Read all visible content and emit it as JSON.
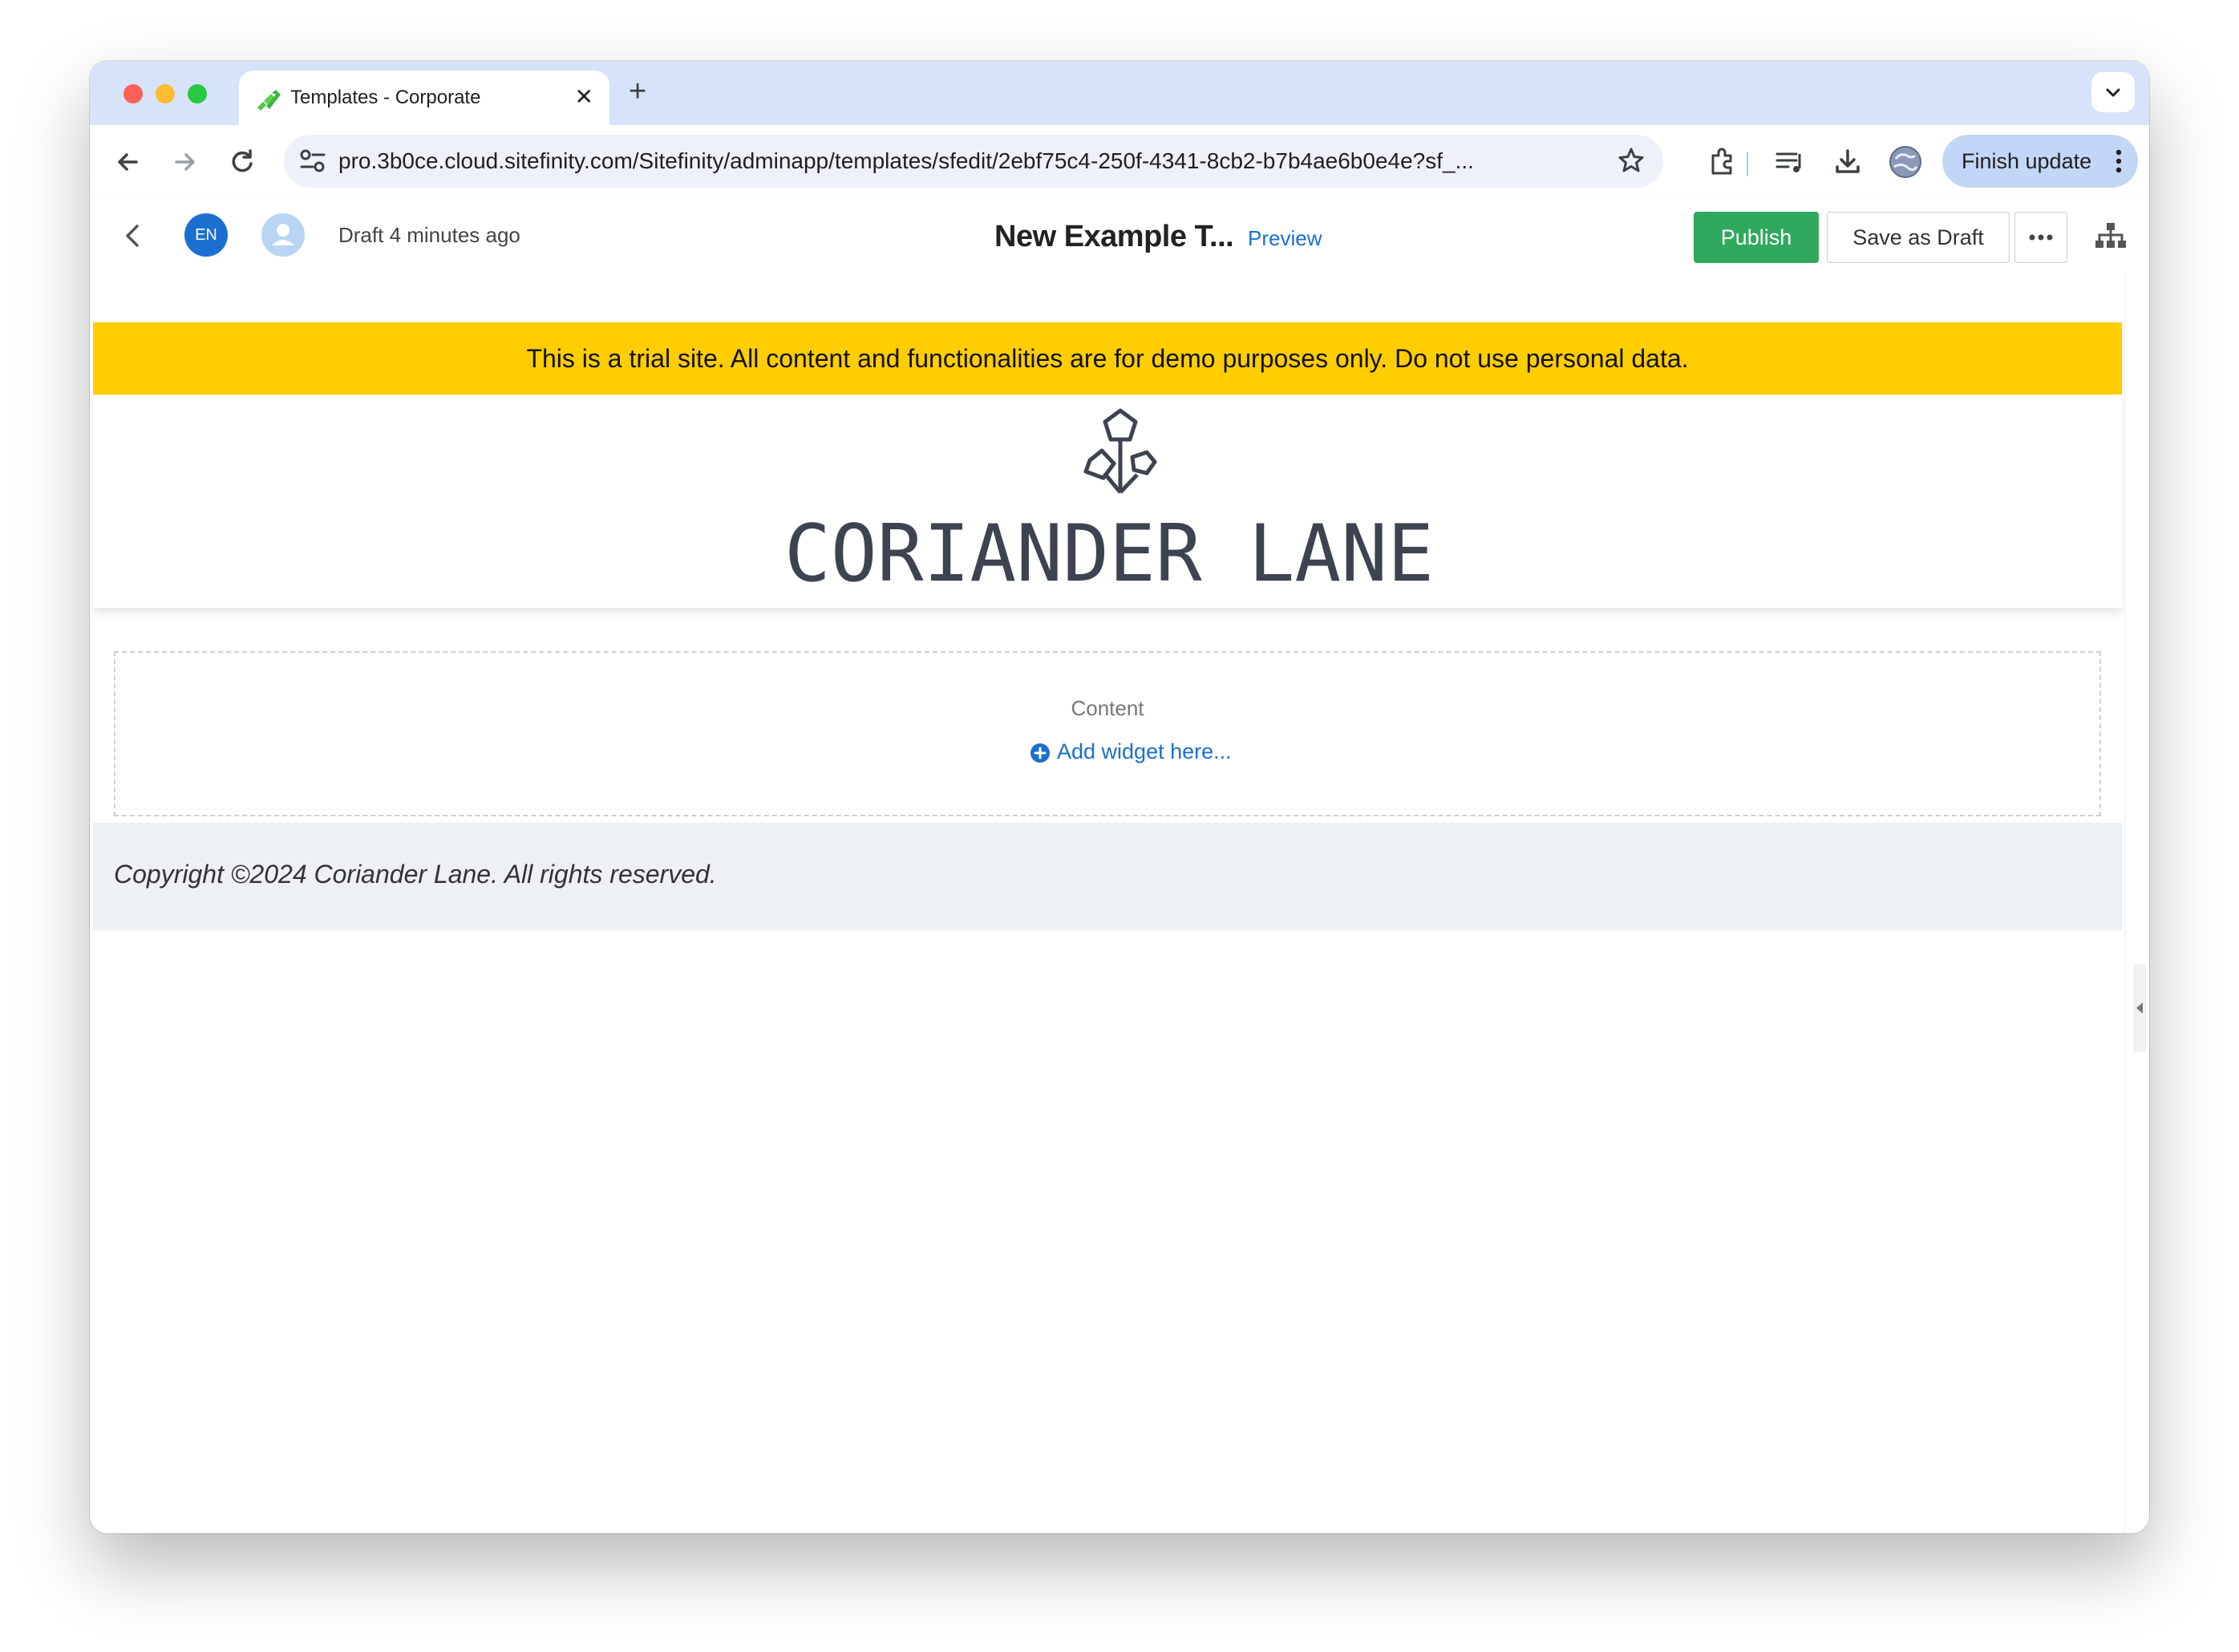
{
  "browser": {
    "tab_title": "Templates - Corporate",
    "url": "pro.3b0ce.cloud.sitefinity.com/Sitefinity/adminapp/templates/sfedit/2ebf75c4-250f-4341-8cb2-b7b4ae6b0e4e?sf_...",
    "finish_update_label": "Finish update"
  },
  "editor": {
    "language_badge": "EN",
    "draft_status": "Draft 4 minutes ago",
    "page_title": "New Example T...",
    "preview_label": "Preview",
    "publish_label": "Publish",
    "save_draft_label": "Save as Draft"
  },
  "page": {
    "trial_banner": "This is a trial site. All content and functionalities are for demo purposes only. Do not use personal data.",
    "logo_text": "CORIANDER LANE",
    "content_zone_label": "Content",
    "add_widget_label": "Add widget here...",
    "copyright": "Copyright ©2024 Coriander Lane. All rights reserved."
  },
  "colors": {
    "publish_green": "#30a95e",
    "link_blue": "#1a6fd1",
    "banner_yellow": "#ffcd00",
    "tab_strip_blue": "#d6e3fa"
  },
  "icons": [
    "sitefinity-favicon",
    "close-icon",
    "plus-icon",
    "chevron-down-icon",
    "back-arrow-icon",
    "forward-arrow-icon",
    "reload-icon",
    "site-settings-icon",
    "star-icon",
    "extensions-icon",
    "media-control-icon",
    "download-icon",
    "profile-icon",
    "more-vert-icon",
    "chevron-left-icon",
    "user-icon",
    "more-horiz-icon",
    "sitemap-icon",
    "add-circle-icon",
    "caret-left-icon"
  ]
}
